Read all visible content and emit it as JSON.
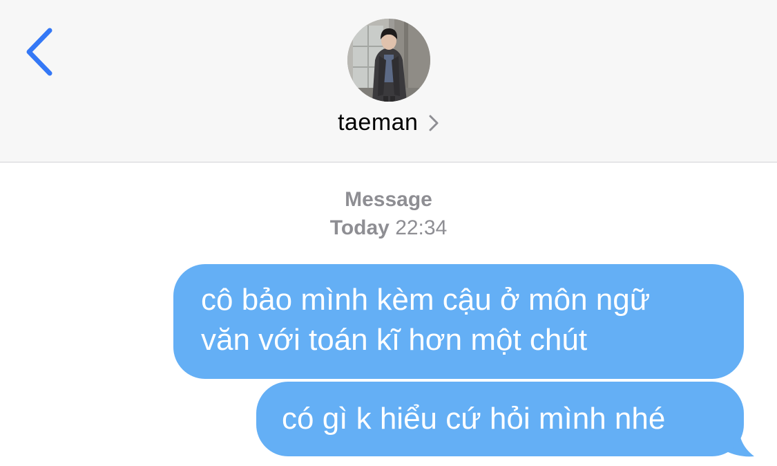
{
  "header": {
    "back_icon": "chevron-left-icon",
    "avatar_icon": "contact-photo",
    "contact_name": "taeman",
    "contact_chevron_icon": "chevron-right-icon"
  },
  "conversation": {
    "service_label": "Message",
    "timestamp_day": "Today",
    "timestamp_time": "22:34",
    "messages": [
      {
        "line1": "cô bảo mình kèm cậu ở môn ngữ",
        "line2": "văn với toán kĩ hơn một chút"
      },
      {
        "text": "có gì k hiểu cứ hỏi mình nhé"
      }
    ]
  },
  "colors": {
    "accent_blue": "#3478f6",
    "bubble_blue": "#64aff5",
    "header_bg": "#f7f7f7",
    "meta_gray": "#8e8e93"
  }
}
